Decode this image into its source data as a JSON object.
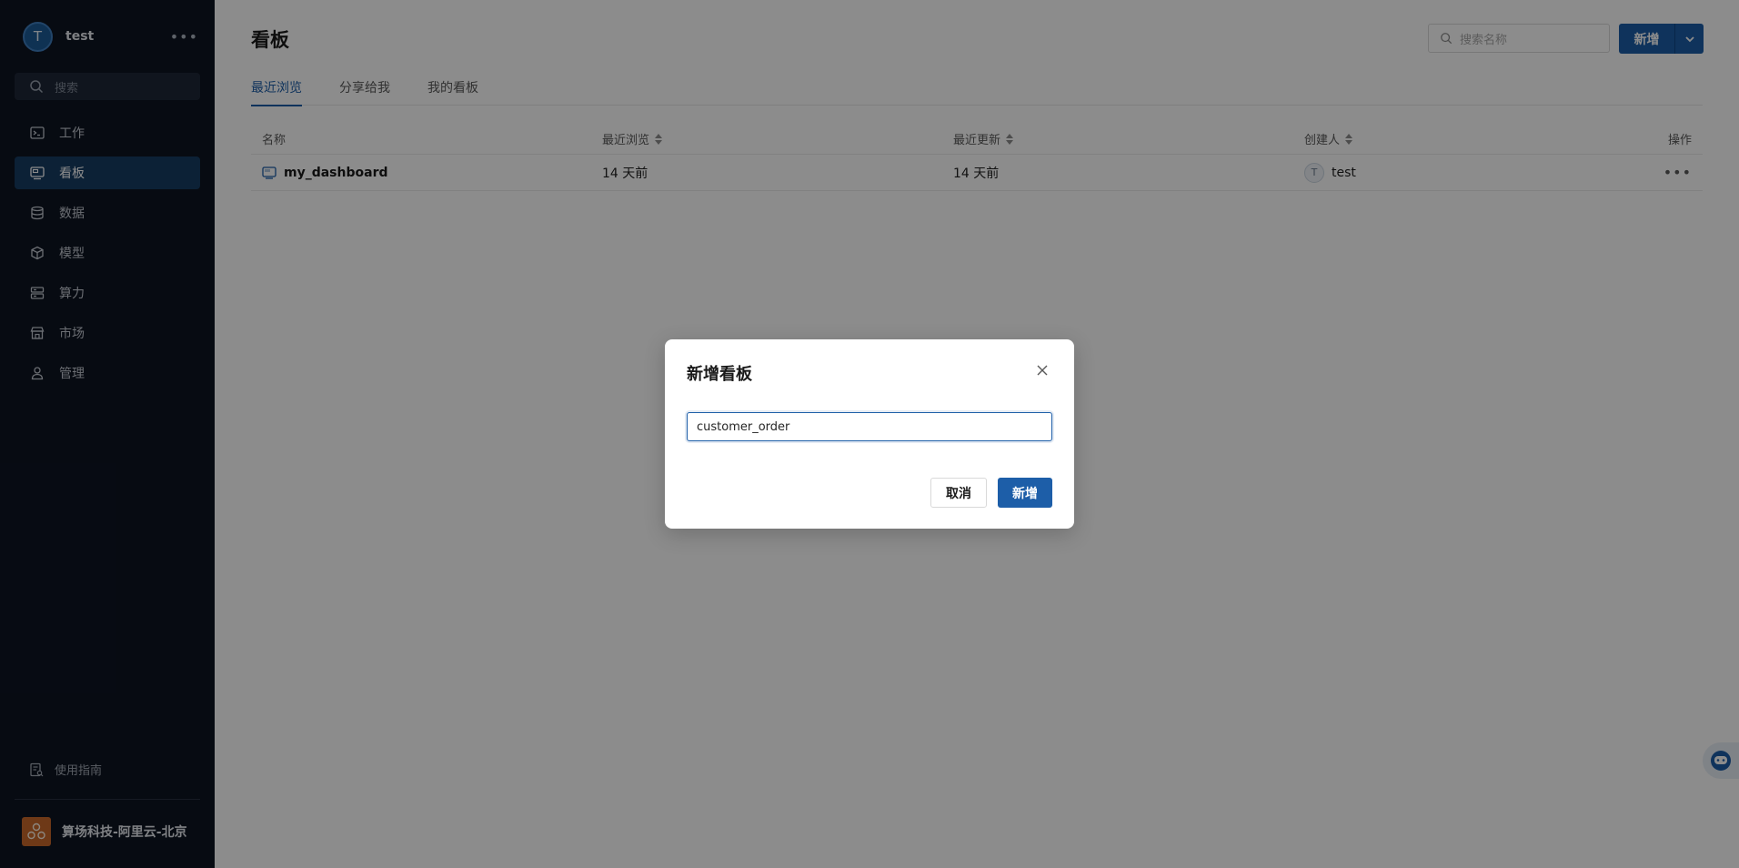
{
  "sidebar": {
    "user": {
      "initial": "T",
      "name": "test"
    },
    "search_placeholder": "搜索",
    "nav": [
      {
        "label": "工作",
        "icon": "terminal-icon"
      },
      {
        "label": "看板",
        "icon": "dashboard-icon"
      },
      {
        "label": "数据",
        "icon": "database-icon"
      },
      {
        "label": "模型",
        "icon": "cube-icon"
      },
      {
        "label": "算力",
        "icon": "server-icon"
      },
      {
        "label": "市场",
        "icon": "store-icon"
      },
      {
        "label": "管理",
        "icon": "person-icon"
      }
    ],
    "active_nav": "看板",
    "guide_label": "使用指南",
    "org_name": "算场科技-阿里云-北京"
  },
  "header": {
    "title": "看板",
    "search_placeholder": "搜索名称",
    "new_button_label": "新增"
  },
  "tabs": [
    {
      "label": "最近浏览",
      "active": true
    },
    {
      "label": "分享给我",
      "active": false
    },
    {
      "label": "我的看板",
      "active": false
    }
  ],
  "table": {
    "columns": [
      "名称",
      "最近浏览",
      "最近更新",
      "创建人",
      "操作"
    ],
    "rows": [
      {
        "name": "my_dashboard",
        "last_viewed": "14 天前",
        "last_updated": "14 天前",
        "creator_initial": "T",
        "creator": "test"
      }
    ]
  },
  "modal": {
    "title": "新增看板",
    "input_value": "customer_order",
    "cancel_label": "取消",
    "ok_label": "新增"
  },
  "colors": {
    "sidebar_bg": "#0d1422",
    "accent": "#1d5ea8",
    "active_nav_bg": "#173d63"
  }
}
